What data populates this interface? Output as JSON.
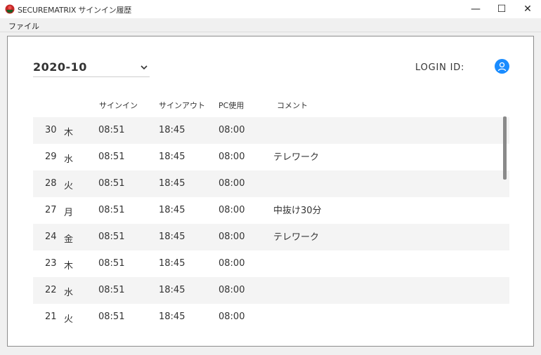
{
  "window": {
    "title": "SECUREMATRIX サインイン履歴",
    "minimize": "—",
    "maximize": "☐",
    "close": "✕"
  },
  "menu": {
    "file": "ファイル"
  },
  "header": {
    "month": "2020-10",
    "login_label": "LOGIN ID:",
    "avatar_color": "#1a8cff"
  },
  "columns": {
    "signin": "サインイン",
    "signout": "サインアウト",
    "pc": "PC使用",
    "comment": "コメント"
  },
  "rows": [
    {
      "day": "30",
      "dow": "木",
      "signin": "08:51",
      "signout": "18:45",
      "pc": "08:00",
      "comment": ""
    },
    {
      "day": "29",
      "dow": "水",
      "signin": "08:51",
      "signout": "18:45",
      "pc": "08:00",
      "comment": "テレワーク"
    },
    {
      "day": "28",
      "dow": "火",
      "signin": "08:51",
      "signout": "18:45",
      "pc": "08:00",
      "comment": ""
    },
    {
      "day": "27",
      "dow": "月",
      "signin": "08:51",
      "signout": "18:45",
      "pc": "08:00",
      "comment": "中抜け30分"
    },
    {
      "day": "24",
      "dow": "金",
      "signin": "08:51",
      "signout": "18:45",
      "pc": "08:00",
      "comment": "テレワーク"
    },
    {
      "day": "23",
      "dow": "木",
      "signin": "08:51",
      "signout": "18:45",
      "pc": "08:00",
      "comment": ""
    },
    {
      "day": "22",
      "dow": "水",
      "signin": "08:51",
      "signout": "18:45",
      "pc": "08:00",
      "comment": ""
    },
    {
      "day": "21",
      "dow": "火",
      "signin": "08:51",
      "signout": "18:45",
      "pc": "08:00",
      "comment": ""
    }
  ]
}
